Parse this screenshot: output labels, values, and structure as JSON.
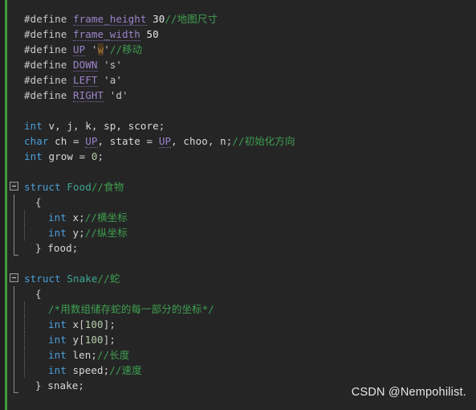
{
  "editor": {
    "background_color": "#252526",
    "gutter_color": "#1f1f1f",
    "change_bar_color": "#3f9b3f",
    "theme_colors": {
      "preprocessor": "#c8c8c8",
      "macro_name": "#9b85c9",
      "comment": "#3f9f4f",
      "keyword": "#4a9fd8",
      "type_name": "#3fa88f",
      "number": "#b5cea8",
      "identifier": "#d8d8d8",
      "char_literal_highlight": "#b07b3a"
    },
    "language": "C"
  },
  "code": {
    "lines": [
      {
        "n": 1,
        "fold": "none",
        "guides": 0,
        "indent": 0,
        "tokens": [
          {
            "t": "pp",
            "v": "#define "
          },
          {
            "t": "macro",
            "v": "frame_height"
          },
          {
            "t": "num",
            "v": " 30"
          },
          {
            "t": "cmt",
            "v": "//地图尺寸"
          }
        ]
      },
      {
        "n": 2,
        "fold": "none",
        "guides": 0,
        "indent": 0,
        "tokens": [
          {
            "t": "pp",
            "v": "#define "
          },
          {
            "t": "macro",
            "v": "frame_width"
          },
          {
            "t": "num",
            "v": " 50"
          }
        ]
      },
      {
        "n": 3,
        "fold": "none",
        "guides": 0,
        "indent": 0,
        "tokens": [
          {
            "t": "pp",
            "v": "#define "
          },
          {
            "t": "macro",
            "v": "UP"
          },
          {
            "t": "chr",
            "v": " '"
          },
          {
            "t": "chr-hl",
            "v": "w"
          },
          {
            "t": "chr",
            "v": "'"
          },
          {
            "t": "cmt",
            "v": "//移动"
          }
        ]
      },
      {
        "n": 4,
        "fold": "none",
        "guides": 0,
        "indent": 0,
        "tokens": [
          {
            "t": "pp",
            "v": "#define "
          },
          {
            "t": "macro",
            "v": "DOWN"
          },
          {
            "t": "chr",
            "v": " 's'"
          }
        ]
      },
      {
        "n": 5,
        "fold": "none",
        "guides": 0,
        "indent": 0,
        "tokens": [
          {
            "t": "pp",
            "v": "#define "
          },
          {
            "t": "macro",
            "v": "LEFT"
          },
          {
            "t": "chr",
            "v": " 'a'"
          }
        ]
      },
      {
        "n": 6,
        "fold": "none",
        "guides": 0,
        "indent": 0,
        "tokens": [
          {
            "t": "pp",
            "v": "#define "
          },
          {
            "t": "macro",
            "v": "RIGHT"
          },
          {
            "t": "chr",
            "v": " 'd'"
          }
        ]
      },
      {
        "n": 7,
        "fold": "none",
        "guides": 0,
        "indent": 0,
        "blank": true,
        "tokens": []
      },
      {
        "n": 8,
        "fold": "none",
        "guides": 0,
        "indent": 0,
        "tokens": [
          {
            "t": "kw",
            "v": "int"
          },
          {
            "t": "id",
            "v": " v, j, k, sp, score"
          },
          {
            "t": "punct",
            "v": ";"
          }
        ]
      },
      {
        "n": 9,
        "fold": "none",
        "guides": 0,
        "indent": 0,
        "tokens": [
          {
            "t": "kw",
            "v": "char"
          },
          {
            "t": "id",
            "v": " ch = "
          },
          {
            "t": "macro",
            "v": "UP"
          },
          {
            "t": "id",
            "v": ", state = "
          },
          {
            "t": "macro",
            "v": "UP"
          },
          {
            "t": "id",
            "v": ", choo, n"
          },
          {
            "t": "punct",
            "v": ";"
          },
          {
            "t": "cmt",
            "v": "//初始化方向"
          }
        ]
      },
      {
        "n": 10,
        "fold": "none",
        "guides": 0,
        "indent": 0,
        "tokens": [
          {
            "t": "kw",
            "v": "int"
          },
          {
            "t": "id",
            "v": " grow = "
          },
          {
            "t": "num-g",
            "v": "0"
          },
          {
            "t": "punct",
            "v": ";"
          }
        ]
      },
      {
        "n": 11,
        "fold": "none",
        "guides": 0,
        "indent": 0,
        "blank": true,
        "tokens": []
      },
      {
        "n": 12,
        "fold": "start",
        "guides": 0,
        "indent": 0,
        "tokens": [
          {
            "t": "kw",
            "v": "struct"
          },
          {
            "t": "type",
            "v": " Food"
          },
          {
            "t": "cmt",
            "v": "//食物"
          }
        ]
      },
      {
        "n": 13,
        "fold": "body",
        "guides": 0,
        "indent": 1,
        "tokens": [
          {
            "t": "punct",
            "v": "{"
          }
        ]
      },
      {
        "n": 14,
        "fold": "body",
        "guides": 1,
        "indent": 2,
        "tokens": [
          {
            "t": "kw",
            "v": "int"
          },
          {
            "t": "id",
            "v": " x"
          },
          {
            "t": "punct",
            "v": ";"
          },
          {
            "t": "cmt",
            "v": "//横坐标"
          }
        ]
      },
      {
        "n": 15,
        "fold": "body",
        "guides": 1,
        "indent": 2,
        "tokens": [
          {
            "t": "kw",
            "v": "int"
          },
          {
            "t": "id",
            "v": " y"
          },
          {
            "t": "punct",
            "v": ";"
          },
          {
            "t": "cmt",
            "v": "//纵坐标"
          }
        ]
      },
      {
        "n": 16,
        "fold": "end",
        "guides": 0,
        "indent": 1,
        "tokens": [
          {
            "t": "punct",
            "v": "}"
          },
          {
            "t": "id",
            "v": " food"
          },
          {
            "t": "punct",
            "v": ";"
          }
        ]
      },
      {
        "n": 17,
        "fold": "none",
        "guides": 0,
        "indent": 0,
        "blank": true,
        "tokens": []
      },
      {
        "n": 18,
        "fold": "start",
        "guides": 0,
        "indent": 0,
        "tokens": [
          {
            "t": "kw",
            "v": "struct"
          },
          {
            "t": "type",
            "v": " Snake"
          },
          {
            "t": "cmt",
            "v": "//蛇"
          }
        ]
      },
      {
        "n": 19,
        "fold": "body",
        "guides": 0,
        "indent": 1,
        "tokens": [
          {
            "t": "punct",
            "v": "{"
          }
        ]
      },
      {
        "n": 20,
        "fold": "body",
        "guides": 1,
        "indent": 2,
        "tokens": [
          {
            "t": "cmt",
            "v": "/*用数组储存蛇的每一部分的坐标*/"
          }
        ]
      },
      {
        "n": 21,
        "fold": "body",
        "guides": 1,
        "indent": 2,
        "tokens": [
          {
            "t": "kw",
            "v": "int"
          },
          {
            "t": "id",
            "v": " x"
          },
          {
            "t": "punct",
            "v": "["
          },
          {
            "t": "num-g",
            "v": "100"
          },
          {
            "t": "punct",
            "v": "];"
          }
        ]
      },
      {
        "n": 22,
        "fold": "body",
        "guides": 1,
        "indent": 2,
        "tokens": [
          {
            "t": "kw",
            "v": "int"
          },
          {
            "t": "id",
            "v": " y"
          },
          {
            "t": "punct",
            "v": "["
          },
          {
            "t": "num-g",
            "v": "100"
          },
          {
            "t": "punct",
            "v": "];"
          }
        ]
      },
      {
        "n": 23,
        "fold": "body",
        "guides": 1,
        "indent": 2,
        "tokens": [
          {
            "t": "kw",
            "v": "int"
          },
          {
            "t": "id",
            "v": " len"
          },
          {
            "t": "punct",
            "v": ";"
          },
          {
            "t": "cmt",
            "v": "//长度"
          }
        ]
      },
      {
        "n": 24,
        "fold": "body",
        "guides": 1,
        "indent": 2,
        "tokens": [
          {
            "t": "kw",
            "v": "int"
          },
          {
            "t": "id",
            "v": " speed"
          },
          {
            "t": "punct",
            "v": ";"
          },
          {
            "t": "cmt",
            "v": "//速度"
          }
        ]
      },
      {
        "n": 25,
        "fold": "end",
        "guides": 0,
        "indent": 1,
        "tokens": [
          {
            "t": "punct",
            "v": "}"
          },
          {
            "t": "id",
            "v": " snake"
          },
          {
            "t": "punct",
            "v": ";"
          }
        ]
      }
    ]
  },
  "watermark": {
    "text": "CSDN @Nempohilist."
  }
}
